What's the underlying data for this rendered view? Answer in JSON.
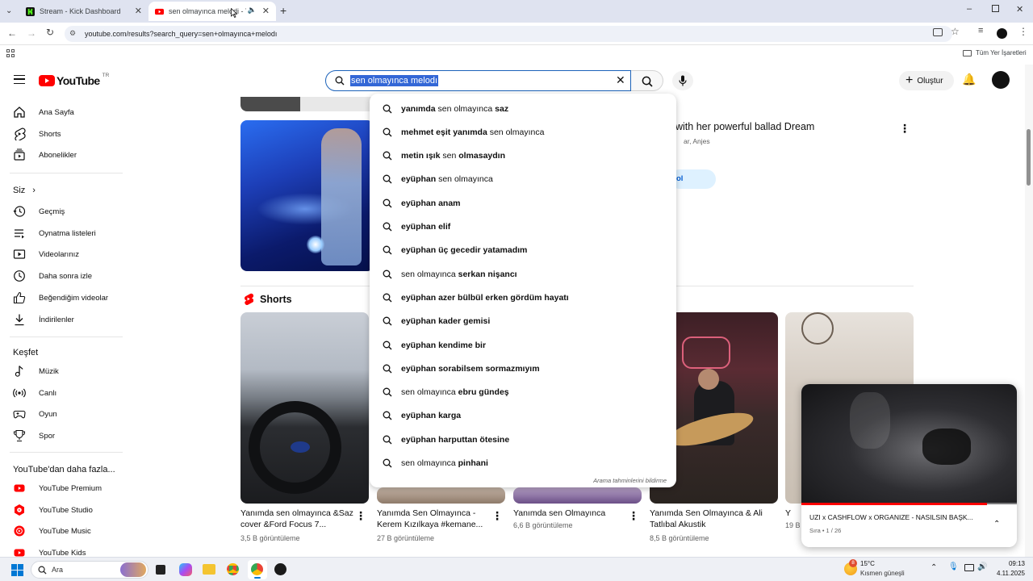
{
  "browser": {
    "tabs": [
      {
        "title": "Stream - Kick Dashboard"
      },
      {
        "title": "sen olmayınca melodi - You"
      }
    ],
    "url": "youtube.com/results?search_query=sen+olmayınca+melodı",
    "bookmarks_all": "Tüm Yer İşaretleri"
  },
  "yt": {
    "logo": "YouTube",
    "region": "TR",
    "search_value": "sen olmayınca melodı",
    "create_label": "Oluştur"
  },
  "sidebar": {
    "main": [
      {
        "label": "Ana Sayfa",
        "icon": "home-icon"
      },
      {
        "label": "Shorts",
        "icon": "shorts-icon"
      },
      {
        "label": "Abonelikler",
        "icon": "subscriptions-icon"
      }
    ],
    "you_title": "Siz",
    "you": [
      {
        "label": "Geçmiş",
        "icon": "history-icon"
      },
      {
        "label": "Oynatma listeleri",
        "icon": "playlists-icon"
      },
      {
        "label": "Videolarınız",
        "icon": "your-videos-icon"
      },
      {
        "label": "Daha sonra izle",
        "icon": "watch-later-icon"
      },
      {
        "label": "Beğendiğim videolar",
        "icon": "liked-icon"
      },
      {
        "label": "İndirilenler",
        "icon": "downloads-icon"
      }
    ],
    "explore_title": "Keşfet",
    "explore": [
      {
        "label": "Müzik",
        "icon": "music-icon"
      },
      {
        "label": "Canlı",
        "icon": "live-icon"
      },
      {
        "label": "Oyun",
        "icon": "gaming-icon"
      },
      {
        "label": "Spor",
        "icon": "sports-icon"
      }
    ],
    "more_title": "YouTube'dan daha fazla...",
    "more": [
      {
        "label": "YouTube Premium"
      },
      {
        "label": "YouTube Studio"
      },
      {
        "label": "YouTube Music"
      },
      {
        "label": "YouTube Kids"
      }
    ]
  },
  "results": {
    "video_title": "with her powerful ballad Dream",
    "video_channel": "ar, Anjes",
    "video_badge": "ol",
    "shorts_title": "Shorts",
    "shorts": [
      {
        "title": "Yanımda sen olmayınca &Saz cover &Ford Focus 7...",
        "views": "3,5 B görüntüleme"
      },
      {
        "title": "Yanımda Sen Olmayınca - Kerem Kızılkaya #kemane...",
        "views": "27 B görüntüleme"
      },
      {
        "title": "Yanımda sen Olmayınca",
        "views": "6,6 B görüntüleme"
      },
      {
        "title": "Yanımda Sen Olmayınca & Ali Tatlıbal Akustik",
        "views": "8,5 B görüntüleme"
      },
      {
        "title": "Y",
        "views": "19 B"
      }
    ]
  },
  "suggestions": [
    {
      "pre": "yanımda ",
      "norm": "sen olmayınca ",
      "post": "saz"
    },
    {
      "pre": "mehmet eşit yanımda ",
      "norm": "sen olmayınca",
      "post": ""
    },
    {
      "pre": "metin ışık ",
      "norm": "sen ",
      "post": "olmasaydın"
    },
    {
      "pre": "eyüphan ",
      "norm": "sen olmayınca",
      "post": ""
    },
    {
      "pre": "eyüphan anam",
      "norm": "",
      "post": ""
    },
    {
      "pre": "eyüphan elif",
      "norm": "",
      "post": ""
    },
    {
      "pre": "eyüphan üç gecedir yatamadım",
      "norm": "",
      "post": ""
    },
    {
      "pre": "",
      "norm": "sen olmayınca ",
      "post": "serkan nişancı"
    },
    {
      "pre": "eyüphan azer bülbül erken gördüm hayatı",
      "norm": "",
      "post": ""
    },
    {
      "pre": "eyüphan kader gemisi",
      "norm": "",
      "post": ""
    },
    {
      "pre": "eyüphan kendime bir",
      "norm": "",
      "post": ""
    },
    {
      "pre": "eyüphan sorabilsem sormazmıyım",
      "norm": "",
      "post": ""
    },
    {
      "pre": "",
      "norm": "sen olmayınca ",
      "post": "ebru gündeş"
    },
    {
      "pre": "eyüphan karga",
      "norm": "",
      "post": ""
    },
    {
      "pre": "eyüphan harputtan ötesine",
      "norm": "",
      "post": ""
    },
    {
      "pre": "",
      "norm": "sen olmayınca ",
      "post": "pinhani"
    }
  ],
  "report_text": "Arama tahminlerini bildirme",
  "miniplayer": {
    "title": "UZI x CASHFLOW x ORGANIZE - NASILSIN BAŞK...",
    "queue": "Sıra • 1 / 26",
    "progress": 0.86
  },
  "taskbar": {
    "search": "Ara",
    "weather_temp": "15°C",
    "weather_desc": "Kısmen güneşli",
    "weather_badge": "8",
    "time": "09:13",
    "date": "4.11.2025"
  },
  "colors": {
    "accent": "#ff0000",
    "link": "#065fd4",
    "selection": "#3367d6"
  }
}
